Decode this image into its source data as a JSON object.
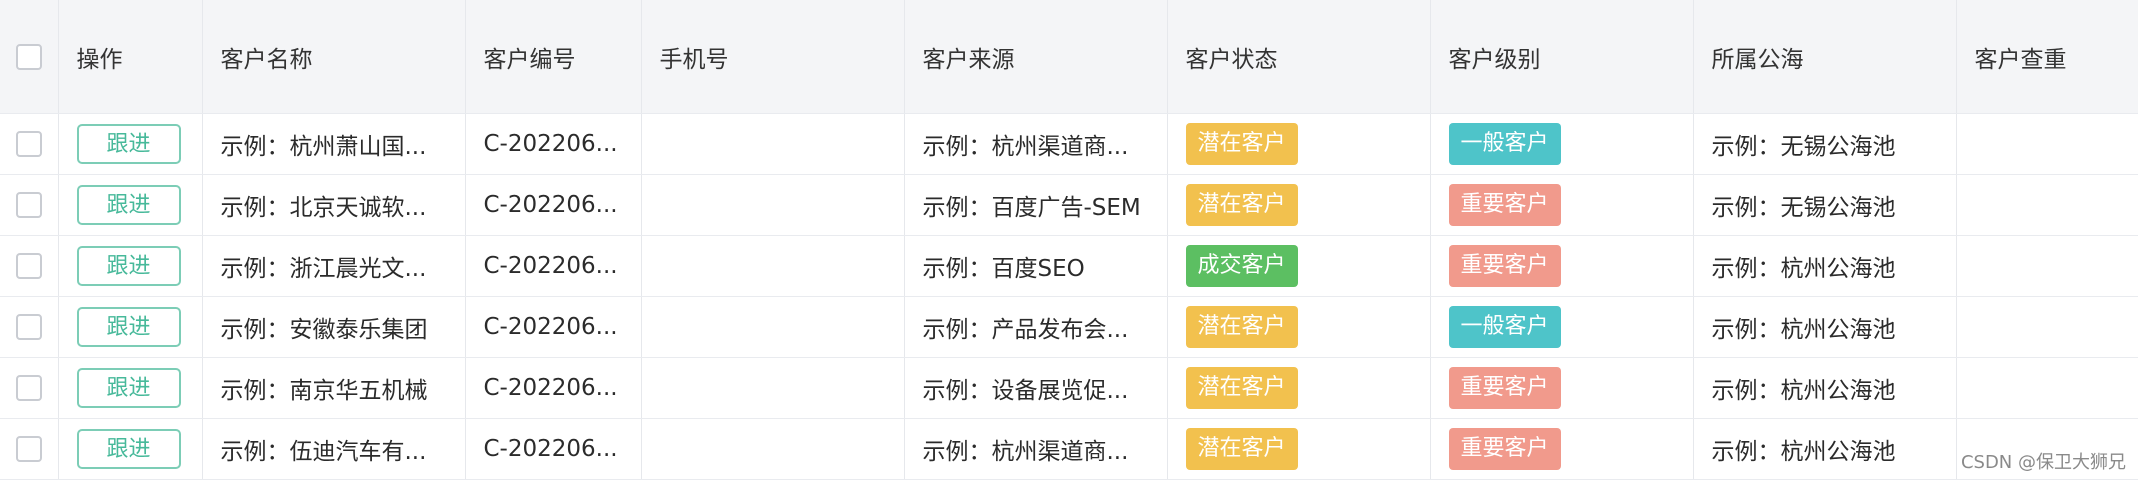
{
  "columns": {
    "action": "操作",
    "name": "客户名称",
    "code": "客户编号",
    "phone": "手机号",
    "source": "客户来源",
    "status": "客户状态",
    "level": "客户级别",
    "pool": "所属公海",
    "dup": "客户查重"
  },
  "rows": [
    {
      "follow": "跟进",
      "name": "示例：杭州萧山国...",
      "code": "C-202206...",
      "phone": "",
      "source": "示例：杭州渠道商...",
      "status": "潜在客户",
      "level": "一般客户",
      "pool": "示例：无锡公海池",
      "dup": ""
    },
    {
      "follow": "跟进",
      "name": "示例：北京天诚软...",
      "code": "C-202206...",
      "phone": "",
      "source": "示例：百度广告-SEM",
      "status": "潜在客户",
      "level": "重要客户",
      "pool": "示例：无锡公海池",
      "dup": ""
    },
    {
      "follow": "跟进",
      "name": "示例：浙江晨光文...",
      "code": "C-202206...",
      "phone": "",
      "source": "示例：百度SEO",
      "status": "成交客户",
      "level": "重要客户",
      "pool": "示例：杭州公海池",
      "dup": ""
    },
    {
      "follow": "跟进",
      "name": "示例：安徽泰乐集团",
      "code": "C-202206...",
      "phone": "",
      "source": "示例：产品发布会...",
      "status": "潜在客户",
      "level": "一般客户",
      "pool": "示例：杭州公海池",
      "dup": ""
    },
    {
      "follow": "跟进",
      "name": "示例：南京华五机械",
      "code": "C-202206...",
      "phone": "",
      "source": "示例：设备展览促...",
      "status": "潜在客户",
      "level": "重要客户",
      "pool": "示例：杭州公海池",
      "dup": ""
    },
    {
      "follow": "跟进",
      "name": "示例：伍迪汽车有...",
      "code": "C-202206...",
      "phone": "",
      "source": "示例：杭州渠道商...",
      "status": "潜在客户",
      "level": "重要客户",
      "pool": "示例：杭州公海池",
      "dup": ""
    }
  ],
  "badge_colors": {
    "潜在客户": "#f2c14e",
    "成交客户": "#5cbf62",
    "一般客户": "#4ec4c9",
    "重要客户": "#f19a8c"
  },
  "watermark": "CSDN @保卫大狮兄"
}
